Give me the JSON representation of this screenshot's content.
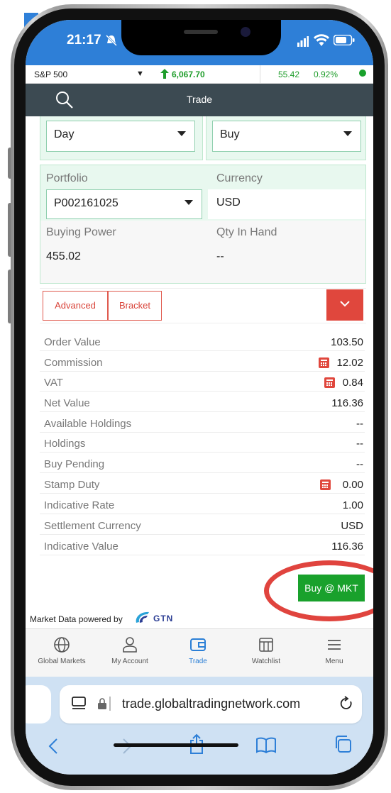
{
  "status": {
    "time": "21:17"
  },
  "ticker": {
    "name": "S&P 500",
    "value": "6,067.70",
    "change": "55.42",
    "percent": "0.92%"
  },
  "header": {
    "title": "Trade"
  },
  "order": {
    "validity": "Day",
    "side": "Buy",
    "portfolio_label": "Portfolio",
    "portfolio_value": "P002161025",
    "currency_label": "Currency",
    "currency_value": "USD",
    "buying_power_label": "Buying Power",
    "buying_power_value": "455.02",
    "qty_label": "Qty In Hand",
    "qty_value": "--"
  },
  "tabs": {
    "advanced": "Advanced",
    "bracket": "Bracket"
  },
  "summary": [
    {
      "label": "Order Value",
      "value": "103.50"
    },
    {
      "label": "Commission",
      "value": "12.02"
    },
    {
      "label": "VAT",
      "value": "0.84"
    },
    {
      "label": "Net Value",
      "value": "116.36"
    },
    {
      "label": "Available Holdings",
      "value": "--"
    },
    {
      "label": "Holdings",
      "value": "--"
    },
    {
      "label": "Buy Pending",
      "value": "--"
    },
    {
      "label": "Stamp Duty",
      "value": "0.00"
    },
    {
      "label": "Indicative Rate",
      "value": "1.00"
    },
    {
      "label": "Settlement Currency",
      "value": "USD"
    },
    {
      "label": "Indicative Value",
      "value": "116.36"
    }
  ],
  "buy_button": "Buy @ MKT",
  "powered_by": "Market Data powered by",
  "gtn_logo_text": "GTN",
  "nav": {
    "global_markets": "Global Markets",
    "my_account": "My Account",
    "trade": "Trade",
    "watchlist": "Watchlist",
    "menu": "Menu"
  },
  "browser": {
    "url": "trade.globaltradingnetwork.com"
  },
  "colors": {
    "accent_blue": "#2e7fd7",
    "header": "#3c4a52",
    "buy_green": "#19a12c",
    "warn_red": "#e0473d"
  }
}
